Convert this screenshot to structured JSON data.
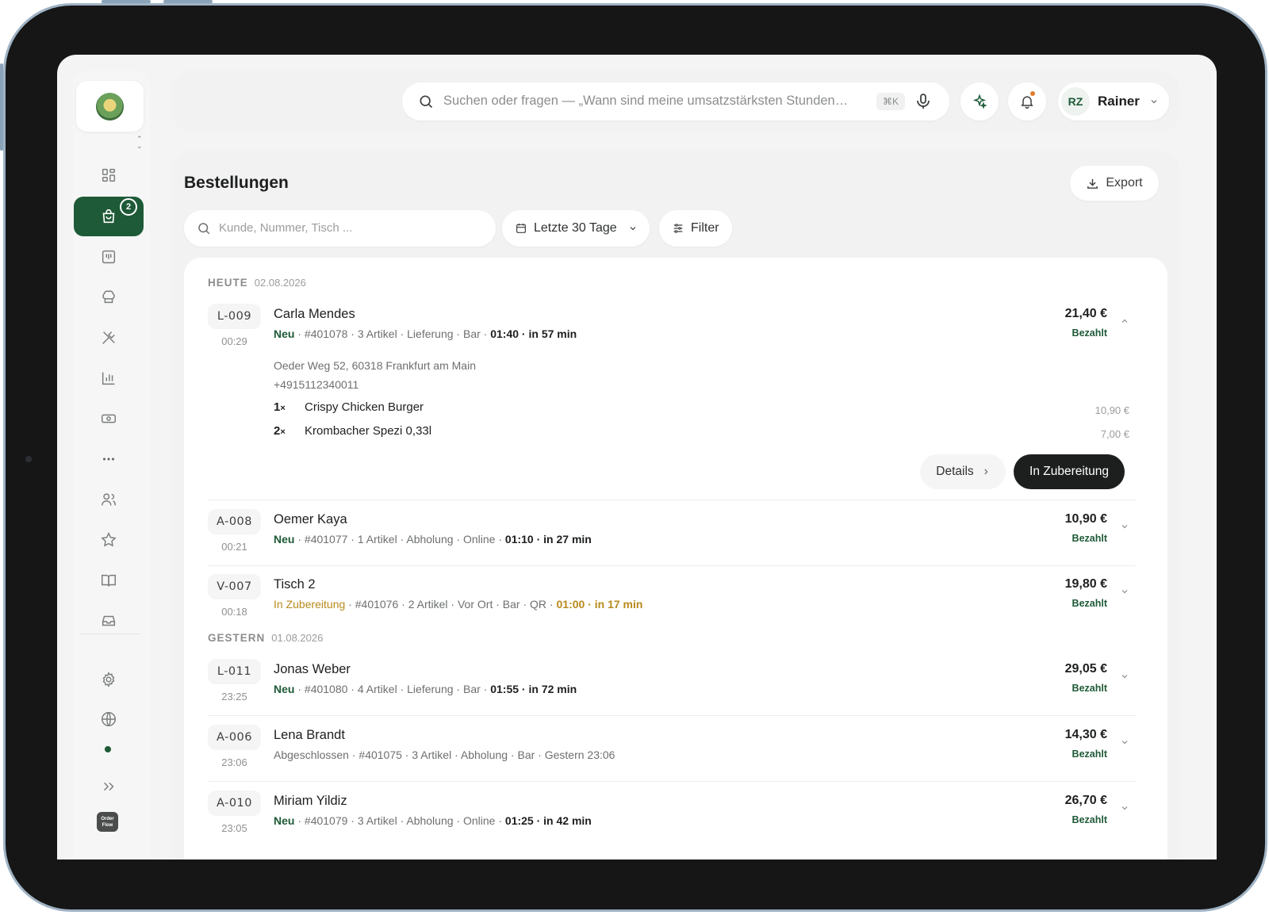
{
  "app": {
    "logo_alt": "Restaurant logo",
    "nav": [
      {
        "name": "nav-dashboard",
        "icon": "dashboard-grid-icon"
      },
      {
        "name": "nav-orders",
        "icon": "shopping-bag-icon",
        "badge": "2",
        "active": true
      },
      {
        "name": "nav-menu-board",
        "icon": "menu-board-icon"
      },
      {
        "name": "nav-kitchen",
        "icon": "chef-hat-icon"
      },
      {
        "name": "nav-utensils",
        "icon": "utensils-crossed-icon"
      },
      {
        "name": "nav-analytics",
        "icon": "bar-chart-icon"
      },
      {
        "name": "nav-payments",
        "icon": "cash-icon"
      },
      {
        "name": "nav-more",
        "icon": "more-dots-icon"
      },
      {
        "name": "nav-customers",
        "icon": "users-icon"
      },
      {
        "name": "nav-reviews",
        "icon": "star-icon"
      },
      {
        "name": "nav-guide",
        "icon": "book-open-icon"
      },
      {
        "name": "nav-inbox",
        "icon": "inbox-tray-icon"
      },
      {
        "name": "nav-settings",
        "icon": "gear-icon"
      },
      {
        "name": "nav-website",
        "icon": "globe-icon"
      },
      {
        "name": "nav-expand",
        "icon": "double-chevron-right-icon"
      }
    ],
    "brand_mark": "Order Flow"
  },
  "topbar": {
    "search_placeholder": "Suchen oder fragen — „Wann sind meine umsatzstärksten Stunden…",
    "shortcut": "⌘K",
    "user_initials": "RZ",
    "user_name": "Rainer"
  },
  "page": {
    "title": "Bestellungen",
    "export_label": "Export",
    "search_placeholder": "Kunde, Nummer, Tisch ...",
    "date_filter": "Letzte 30 Tage",
    "filter_label": "Filter"
  },
  "groups": [
    {
      "label": "HEUTE",
      "date": "02.08.2026"
    },
    {
      "label": "GESTERN",
      "date": "01.08.2026"
    }
  ],
  "orders": [
    {
      "code": "L-009",
      "time": "00:29",
      "customer": "Carla Mendes",
      "status": "Neu",
      "number": "#401078",
      "items_count": "3 Artikel",
      "type": "Lieferung",
      "channel": "Bar",
      "eta": "01:40",
      "eta_rel": "in 57 min",
      "amount": "21,40 €",
      "payment": "Bezahlt",
      "expanded": true,
      "address": "Oeder Weg 52, 60318 Frankfurt am Main",
      "phone": "+4915112340011",
      "items": [
        {
          "qty": "1",
          "name": "Crispy Chicken Burger",
          "price": "10,90 €"
        },
        {
          "qty": "2",
          "name": "Krombacher Spezi 0,33l",
          "price": "7,00 €"
        }
      ],
      "details_label": "Details",
      "action_label": "In Zubereitung"
    },
    {
      "code": "A-008",
      "time": "00:21",
      "customer": "Oemer Kaya",
      "status": "Neu",
      "number": "#401077",
      "items_count": "1 Artikel",
      "type": "Abholung",
      "channel": "Online",
      "eta": "01:10",
      "eta_rel": "in 27 min",
      "amount": "10,90 €",
      "payment": "Bezahlt"
    },
    {
      "code": "V-007",
      "time": "00:18",
      "customer": "Tisch 2",
      "status": "In Zubereitung",
      "number": "#401076",
      "items_count": "2 Artikel",
      "type": "Vor Ort",
      "channel": "Bar",
      "extra": "QR",
      "eta": "01:00",
      "eta_rel": "in 17 min",
      "amount": "19,80 €",
      "payment": "Bezahlt"
    },
    {
      "code": "L-011",
      "time": "23:25",
      "customer": "Jonas Weber",
      "status": "Neu",
      "number": "#401080",
      "items_count": "4 Artikel",
      "type": "Lieferung",
      "channel": "Bar",
      "eta": "01:55",
      "eta_rel": "in 72 min",
      "amount": "29,05 €",
      "payment": "Bezahlt"
    },
    {
      "code": "A-006",
      "time": "23:06",
      "customer": "Lena Brandt",
      "status": "Abgeschlossen",
      "number": "#401075",
      "items_count": "3 Artikel",
      "type": "Abholung",
      "channel": "Bar",
      "completed_at": "Gestern 23:06",
      "amount": "14,30 €",
      "payment": "Bezahlt"
    },
    {
      "code": "A-010",
      "time": "23:05",
      "customer": "Miriam Yildiz",
      "status": "Neu",
      "number": "#401079",
      "items_count": "3 Artikel",
      "type": "Abholung",
      "channel": "Online",
      "eta": "01:25",
      "eta_rel": "in 42 min",
      "amount": "26,70 €",
      "payment": "Bezahlt"
    }
  ],
  "colors": {
    "accent": "#1e5a37",
    "prep": "#b88a1c",
    "notification": "#e07b2f"
  }
}
